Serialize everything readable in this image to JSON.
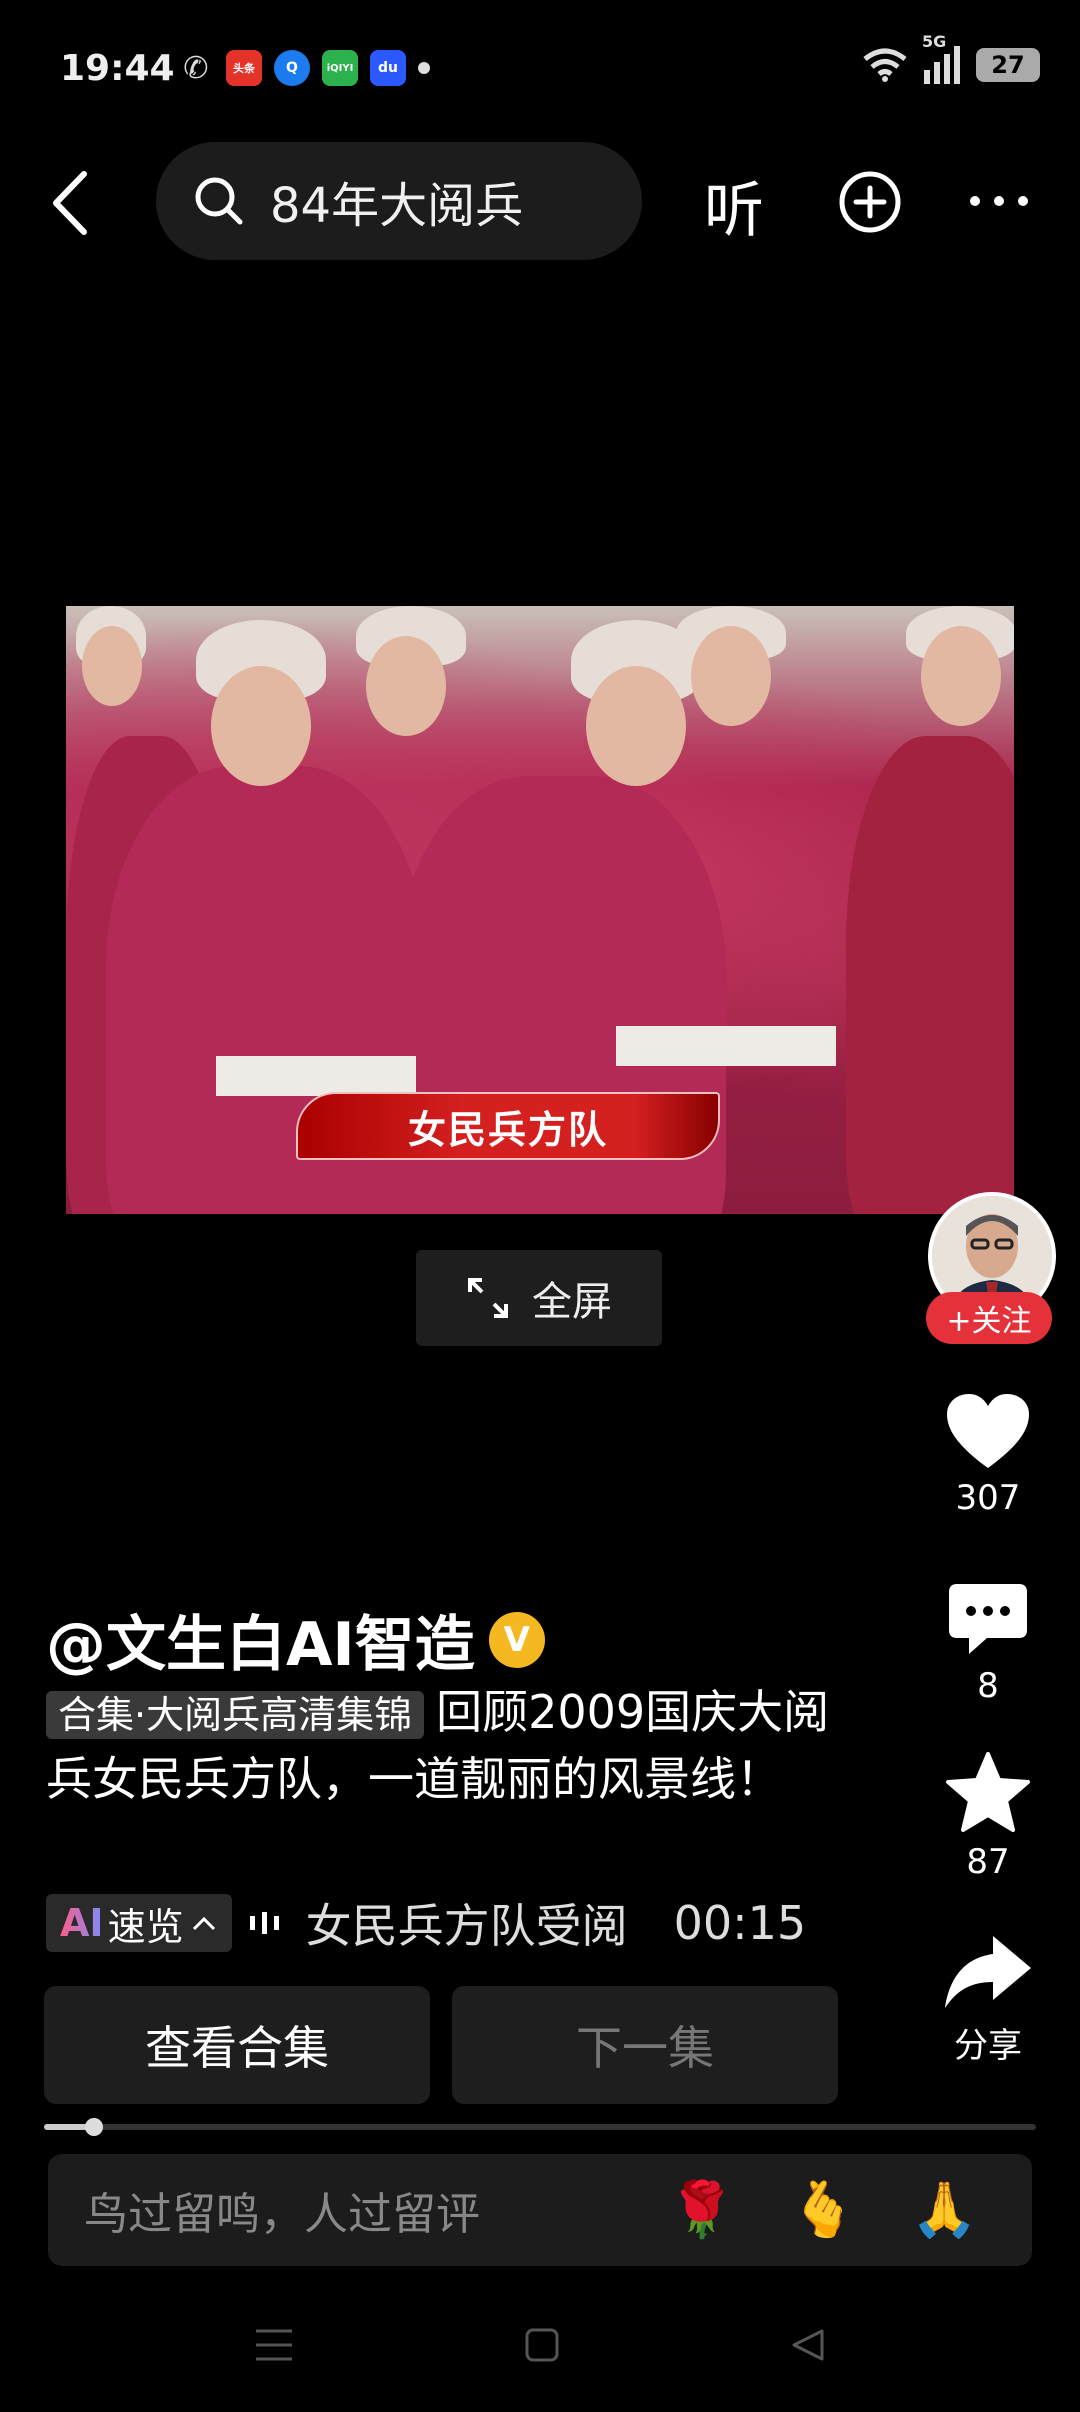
{
  "status_bar": {
    "time": "19:44",
    "network": "5G",
    "battery": "27"
  },
  "notifications": [
    {
      "name": "wechat-icon",
      "label": "✆"
    },
    {
      "name": "toutiao-icon",
      "label": "头条"
    },
    {
      "name": "q-app-icon",
      "label": "Q"
    },
    {
      "name": "iqiyi-icon",
      "label": "iQIYI"
    },
    {
      "name": "baidu-icon",
      "label": "du"
    }
  ],
  "header": {
    "search_query": "84年大阅兵",
    "listen_label": "听"
  },
  "video": {
    "caption": "女民兵方队",
    "fullscreen_label": "全屏"
  },
  "rail": {
    "follow_label": "+关注",
    "likes": "307",
    "comments": "8",
    "favorites": "87",
    "share_label": "分享"
  },
  "post": {
    "author": "@文生白AI智造",
    "verified_mark": "V",
    "collection_tag": "合集·大阅兵高清集锦",
    "description": "回顾2009国庆大阅兵女民兵方队，一道靓丽的风景线！",
    "ai_label": "AI",
    "ai_chip": "速览",
    "ai_summary": "女民兵方队受阅",
    "ai_time": "00:15"
  },
  "actions": {
    "view_collection": "查看合集",
    "next_episode": "下一集"
  },
  "playback": {
    "progress": 0.05
  },
  "comment": {
    "placeholder": "鸟过留鸣，人过留评",
    "emojis": [
      "🌹",
      "🫰",
      "🙏"
    ]
  }
}
